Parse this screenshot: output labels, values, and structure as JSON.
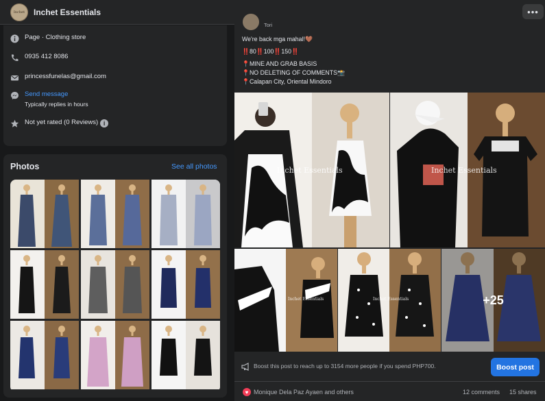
{
  "header": {
    "page_name": "Inchet Essentials",
    "avatar_text": "Inchet",
    "more_label": "•••"
  },
  "intro": {
    "category": "Page · Clothing store",
    "phone": "0935 412 8086",
    "email": "princessfunelas@gmail.com",
    "send_message": "Send message",
    "reply_note": "Typically replies in hours",
    "rating": "Not yet rated (0 Reviews)",
    "rating_info_glyph": "i"
  },
  "photos": {
    "title": "Photos",
    "see_all": "See all photos"
  },
  "post": {
    "author": "Tori",
    "lines": [
      "We're back mga mahal!🤎",
      "‼️80‼️100‼️150‼️",
      "📍MINE AND GRAB BASIS",
      "📍NO DELETING OF COMMENTS📸",
      "📍Calapan City, Oriental Mindoro"
    ],
    "watermark": "Inchet Essentials",
    "more_count": "+25",
    "boost_text": "Boost this post to reach up to 3154 more people if you spend PHP700.",
    "boost_button": "Boost post",
    "reactors": "Monique Dela Paz Ayaen and others",
    "comments": "12 comments",
    "shares": "15 shares"
  },
  "colors": {
    "background": "#18191a",
    "card": "#242526",
    "link": "#4599ff",
    "primary_button": "#2374e1",
    "text": "#e4e6eb",
    "secondary_text": "#b0b3b8"
  },
  "icons": {
    "category": "info-icon",
    "phone": "phone-icon",
    "email": "mail-icon",
    "messenger": "messenger-icon",
    "rating": "star-icon",
    "boost": "megaphone-icon",
    "reaction": "heart-icon"
  }
}
